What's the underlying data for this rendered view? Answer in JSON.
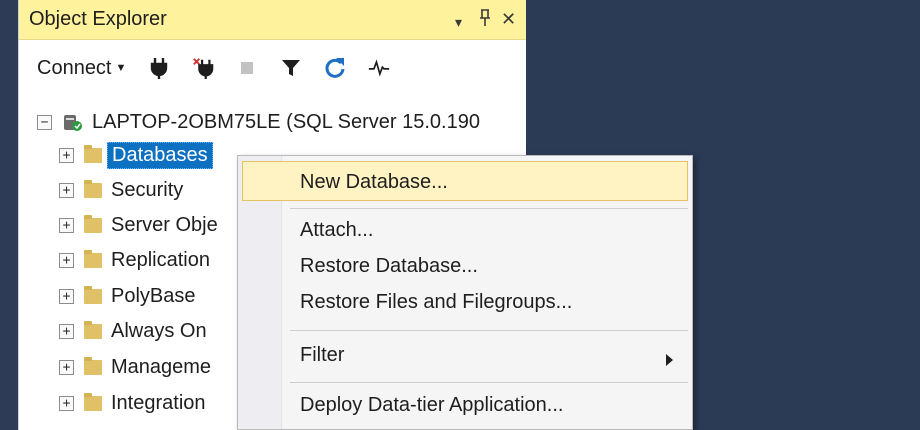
{
  "panel": {
    "title": "Object Explorer",
    "controls": {
      "dropdown": "▾",
      "pin": "⊥",
      "close": "✕"
    }
  },
  "toolbar": {
    "connect_label": "Connect",
    "icons": [
      "connect-plug-icon",
      "disconnect-plug-icon",
      "stop-icon",
      "filter-icon",
      "refresh-icon",
      "activity-monitor-icon"
    ]
  },
  "tree": {
    "server": "LAPTOP-2OBM75LE (SQL Server 15.0.190",
    "nodes": [
      {
        "label": "Databases",
        "selected": true
      },
      {
        "label": "Security"
      },
      {
        "label": "Server Obje"
      },
      {
        "label": "Replication"
      },
      {
        "label": "PolyBase"
      },
      {
        "label": "Always On"
      },
      {
        "label": "Manageme"
      },
      {
        "label": "Integration"
      }
    ]
  },
  "context_menu": {
    "items": [
      {
        "label": "New Database...",
        "highlighted": true
      },
      {
        "label": "Attach..."
      },
      {
        "label": "Restore Database..."
      },
      {
        "label": "Restore Files and Filegroups..."
      },
      {
        "label": "Filter",
        "submenu": true
      },
      {
        "label": "Deploy Data-tier Application..."
      }
    ]
  },
  "colors": {
    "title_bar": "#fff29d",
    "selection": "#0e70c0",
    "menu_highlight": "#fff3c4",
    "background": "#2b3a55",
    "folder": "#e0c168"
  }
}
